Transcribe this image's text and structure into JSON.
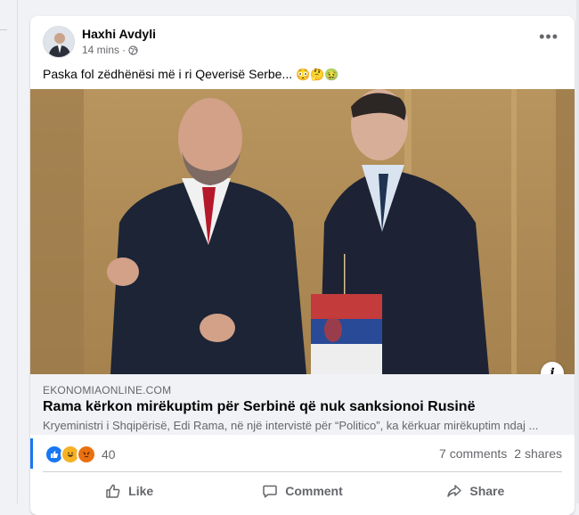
{
  "post": {
    "author": "Haxhi Avdyli",
    "time": "14 mins",
    "text": "Paska fol zëdhënësi më i ri Qeverisë Serbe...",
    "emojis": "😳🤔🤢"
  },
  "link": {
    "domain": "EKONOMIAONLINE.COM",
    "title": "Rama kërkon mirëkuptim për Serbinë që nuk sanksionoi Rusinë",
    "description": "Kryeministri i Shqipërisë, Edi Rama, në një intervistë për “Politico”, ka kërkuar mirëkuptim ndaj ..."
  },
  "stats": {
    "reaction_count": "40",
    "comments": "7 comments",
    "shares": "2 shares"
  },
  "actions": {
    "like": "Like",
    "comment": "Comment",
    "share": "Share"
  },
  "icons": [
    "globe-icon",
    "more-icon",
    "info-icon",
    "like-reaction-icon",
    "haha-reaction-icon",
    "angry-reaction-icon",
    "thumbs-up-icon",
    "comment-icon",
    "share-icon"
  ],
  "colors": {
    "accent": "#1877f2",
    "muted": "#65676b",
    "surface": "#f0f2f5"
  }
}
